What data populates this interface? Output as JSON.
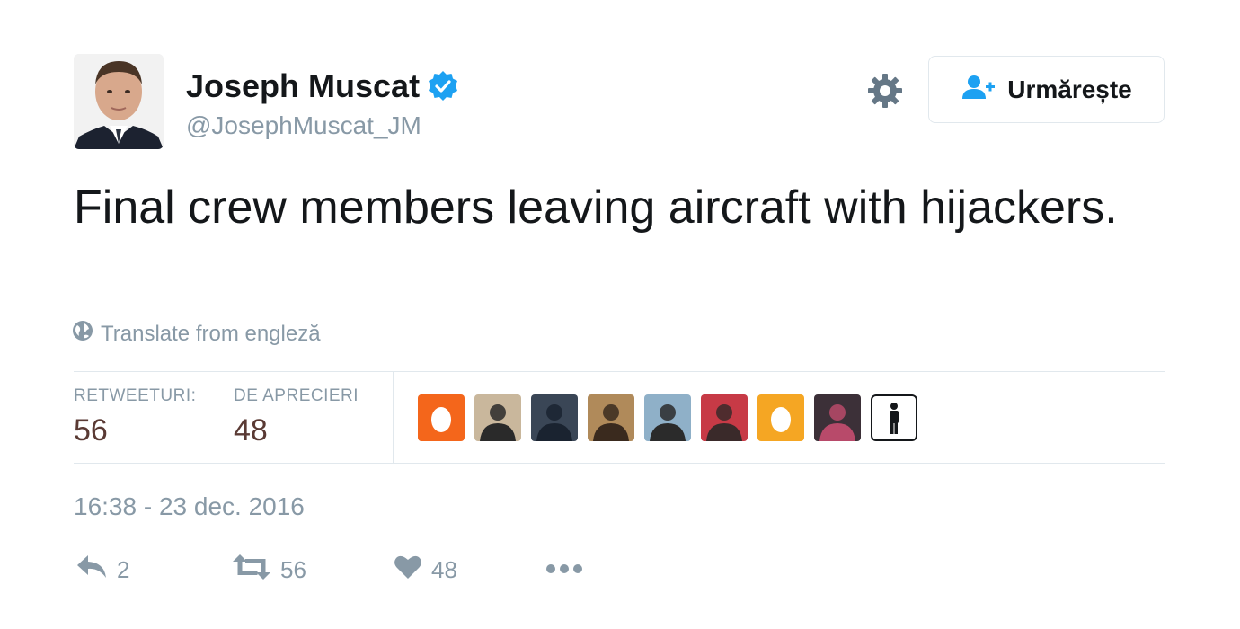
{
  "author": {
    "name": "Joseph Muscat",
    "handle": "@JosephMuscat_JM",
    "verified": true
  },
  "header": {
    "follow_label": "Urmărește"
  },
  "tweet": {
    "text": "Final crew members leaving aircraft with hijackers.",
    "translate_label": "Translate from engleză",
    "timestamp": "16:38 - 23 dec. 2016"
  },
  "stats": {
    "retweets_label": "RETWEETURI:",
    "retweets_value": "56",
    "likes_label": "DE APRECIERI",
    "likes_value": "48"
  },
  "likers": [
    {
      "kind": "egg",
      "color": "#f4661b"
    },
    {
      "kind": "photo",
      "bg": "#c9b79c",
      "fg": "#2a2a2a"
    },
    {
      "kind": "photo",
      "bg": "#3a4656",
      "fg": "#1a2330"
    },
    {
      "kind": "photo",
      "bg": "#b08a5a",
      "fg": "#3a2a1e"
    },
    {
      "kind": "photo",
      "bg": "#8fb0c8",
      "fg": "#2b2b2b"
    },
    {
      "kind": "photo",
      "bg": "#c73a46",
      "fg": "#3a2a2a"
    },
    {
      "kind": "egg",
      "color": "#f5a623"
    },
    {
      "kind": "photo",
      "bg": "#3c3038",
      "fg": "#b84a6a"
    },
    {
      "kind": "icon",
      "icon": "person-icon"
    }
  ],
  "actions": {
    "reply_count": "2",
    "retweet_count": "56",
    "like_count": "48"
  },
  "colors": {
    "verified": "#1da1f2",
    "follow_icon": "#1da1f2",
    "muted": "#8899a6",
    "stat_value": "#5a3a34"
  }
}
